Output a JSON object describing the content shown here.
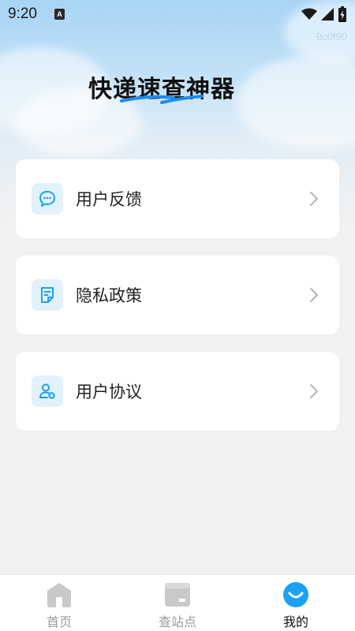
{
  "status_bar": {
    "time": "9:20",
    "notification_icon": "a-badge",
    "notification_letter": "A",
    "icons": [
      "wifi-icon",
      "signal-icon",
      "battery-charging-icon"
    ]
  },
  "watermark": "9c0f90",
  "app_title": "快递速查神器",
  "menu": [
    {
      "label": "用户反馈",
      "icon": "chat-bubble-icon"
    },
    {
      "label": "隐私政策",
      "icon": "document-icon"
    },
    {
      "label": "用户协议",
      "icon": "user-agreement-icon"
    }
  ],
  "tabs": [
    {
      "label": "首页",
      "icon": "home-icon",
      "active": false
    },
    {
      "label": "查站点",
      "icon": "station-icon",
      "active": false
    },
    {
      "label": "我的",
      "icon": "profile-smile-icon",
      "active": true
    }
  ],
  "colors": {
    "accent": "#1da1f2",
    "icon_bg": "#e2f2fd",
    "inactive": "#c9c9c9",
    "title_swoosh": "#1f8bea"
  }
}
